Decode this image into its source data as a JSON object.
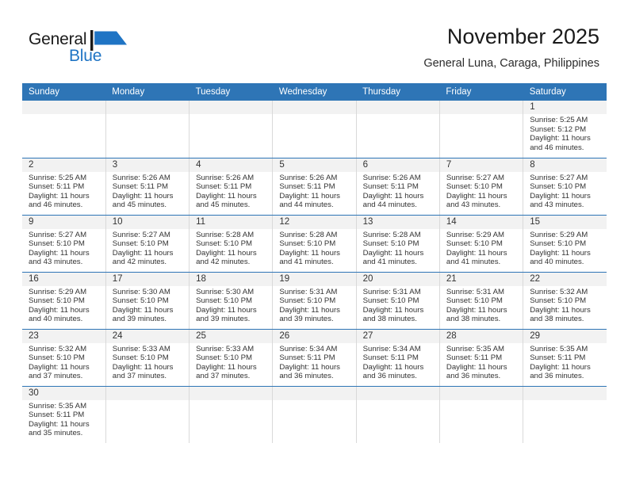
{
  "brand": {
    "name_top": "General",
    "name_bottom": "Blue",
    "accent_color": "#1f74c4",
    "flag_icon": "general-blue-flag"
  },
  "header": {
    "title": "November 2025",
    "subtitle": "General Luna, Caraga, Philippines"
  },
  "theme": {
    "header_blue": "#2e75b6",
    "daynum_band": "#f2f2f2",
    "cell_border": "#d9d9d9",
    "text": "#333333"
  },
  "calendar": {
    "weekday_headers": [
      "Sunday",
      "Monday",
      "Tuesday",
      "Wednesday",
      "Thursday",
      "Friday",
      "Saturday"
    ],
    "weeks": [
      [
        {
          "day": "",
          "empty": true,
          "sunrise": "",
          "sunset": "",
          "daylight_line1": "",
          "daylight_line2": ""
        },
        {
          "day": "",
          "empty": true,
          "sunrise": "",
          "sunset": "",
          "daylight_line1": "",
          "daylight_line2": ""
        },
        {
          "day": "",
          "empty": true,
          "sunrise": "",
          "sunset": "",
          "daylight_line1": "",
          "daylight_line2": ""
        },
        {
          "day": "",
          "empty": true,
          "sunrise": "",
          "sunset": "",
          "daylight_line1": "",
          "daylight_line2": ""
        },
        {
          "day": "",
          "empty": true,
          "sunrise": "",
          "sunset": "",
          "daylight_line1": "",
          "daylight_line2": ""
        },
        {
          "day": "",
          "empty": true,
          "sunrise": "",
          "sunset": "",
          "daylight_line1": "",
          "daylight_line2": ""
        },
        {
          "day": "1",
          "empty": false,
          "sunrise": "Sunrise: 5:25 AM",
          "sunset": "Sunset: 5:12 PM",
          "daylight_line1": "Daylight: 11 hours",
          "daylight_line2": "and 46 minutes."
        }
      ],
      [
        {
          "day": "2",
          "empty": false,
          "sunrise": "Sunrise: 5:25 AM",
          "sunset": "Sunset: 5:11 PM",
          "daylight_line1": "Daylight: 11 hours",
          "daylight_line2": "and 46 minutes."
        },
        {
          "day": "3",
          "empty": false,
          "sunrise": "Sunrise: 5:26 AM",
          "sunset": "Sunset: 5:11 PM",
          "daylight_line1": "Daylight: 11 hours",
          "daylight_line2": "and 45 minutes."
        },
        {
          "day": "4",
          "empty": false,
          "sunrise": "Sunrise: 5:26 AM",
          "sunset": "Sunset: 5:11 PM",
          "daylight_line1": "Daylight: 11 hours",
          "daylight_line2": "and 45 minutes."
        },
        {
          "day": "5",
          "empty": false,
          "sunrise": "Sunrise: 5:26 AM",
          "sunset": "Sunset: 5:11 PM",
          "daylight_line1": "Daylight: 11 hours",
          "daylight_line2": "and 44 minutes."
        },
        {
          "day": "6",
          "empty": false,
          "sunrise": "Sunrise: 5:26 AM",
          "sunset": "Sunset: 5:11 PM",
          "daylight_line1": "Daylight: 11 hours",
          "daylight_line2": "and 44 minutes."
        },
        {
          "day": "7",
          "empty": false,
          "sunrise": "Sunrise: 5:27 AM",
          "sunset": "Sunset: 5:10 PM",
          "daylight_line1": "Daylight: 11 hours",
          "daylight_line2": "and 43 minutes."
        },
        {
          "day": "8",
          "empty": false,
          "sunrise": "Sunrise: 5:27 AM",
          "sunset": "Sunset: 5:10 PM",
          "daylight_line1": "Daylight: 11 hours",
          "daylight_line2": "and 43 minutes."
        }
      ],
      [
        {
          "day": "9",
          "empty": false,
          "sunrise": "Sunrise: 5:27 AM",
          "sunset": "Sunset: 5:10 PM",
          "daylight_line1": "Daylight: 11 hours",
          "daylight_line2": "and 43 minutes."
        },
        {
          "day": "10",
          "empty": false,
          "sunrise": "Sunrise: 5:27 AM",
          "sunset": "Sunset: 5:10 PM",
          "daylight_line1": "Daylight: 11 hours",
          "daylight_line2": "and 42 minutes."
        },
        {
          "day": "11",
          "empty": false,
          "sunrise": "Sunrise: 5:28 AM",
          "sunset": "Sunset: 5:10 PM",
          "daylight_line1": "Daylight: 11 hours",
          "daylight_line2": "and 42 minutes."
        },
        {
          "day": "12",
          "empty": false,
          "sunrise": "Sunrise: 5:28 AM",
          "sunset": "Sunset: 5:10 PM",
          "daylight_line1": "Daylight: 11 hours",
          "daylight_line2": "and 41 minutes."
        },
        {
          "day": "13",
          "empty": false,
          "sunrise": "Sunrise: 5:28 AM",
          "sunset": "Sunset: 5:10 PM",
          "daylight_line1": "Daylight: 11 hours",
          "daylight_line2": "and 41 minutes."
        },
        {
          "day": "14",
          "empty": false,
          "sunrise": "Sunrise: 5:29 AM",
          "sunset": "Sunset: 5:10 PM",
          "daylight_line1": "Daylight: 11 hours",
          "daylight_line2": "and 41 minutes."
        },
        {
          "day": "15",
          "empty": false,
          "sunrise": "Sunrise: 5:29 AM",
          "sunset": "Sunset: 5:10 PM",
          "daylight_line1": "Daylight: 11 hours",
          "daylight_line2": "and 40 minutes."
        }
      ],
      [
        {
          "day": "16",
          "empty": false,
          "sunrise": "Sunrise: 5:29 AM",
          "sunset": "Sunset: 5:10 PM",
          "daylight_line1": "Daylight: 11 hours",
          "daylight_line2": "and 40 minutes."
        },
        {
          "day": "17",
          "empty": false,
          "sunrise": "Sunrise: 5:30 AM",
          "sunset": "Sunset: 5:10 PM",
          "daylight_line1": "Daylight: 11 hours",
          "daylight_line2": "and 39 minutes."
        },
        {
          "day": "18",
          "empty": false,
          "sunrise": "Sunrise: 5:30 AM",
          "sunset": "Sunset: 5:10 PM",
          "daylight_line1": "Daylight: 11 hours",
          "daylight_line2": "and 39 minutes."
        },
        {
          "day": "19",
          "empty": false,
          "sunrise": "Sunrise: 5:31 AM",
          "sunset": "Sunset: 5:10 PM",
          "daylight_line1": "Daylight: 11 hours",
          "daylight_line2": "and 39 minutes."
        },
        {
          "day": "20",
          "empty": false,
          "sunrise": "Sunrise: 5:31 AM",
          "sunset": "Sunset: 5:10 PM",
          "daylight_line1": "Daylight: 11 hours",
          "daylight_line2": "and 38 minutes."
        },
        {
          "day": "21",
          "empty": false,
          "sunrise": "Sunrise: 5:31 AM",
          "sunset": "Sunset: 5:10 PM",
          "daylight_line1": "Daylight: 11 hours",
          "daylight_line2": "and 38 minutes."
        },
        {
          "day": "22",
          "empty": false,
          "sunrise": "Sunrise: 5:32 AM",
          "sunset": "Sunset: 5:10 PM",
          "daylight_line1": "Daylight: 11 hours",
          "daylight_line2": "and 38 minutes."
        }
      ],
      [
        {
          "day": "23",
          "empty": false,
          "sunrise": "Sunrise: 5:32 AM",
          "sunset": "Sunset: 5:10 PM",
          "daylight_line1": "Daylight: 11 hours",
          "daylight_line2": "and 37 minutes."
        },
        {
          "day": "24",
          "empty": false,
          "sunrise": "Sunrise: 5:33 AM",
          "sunset": "Sunset: 5:10 PM",
          "daylight_line1": "Daylight: 11 hours",
          "daylight_line2": "and 37 minutes."
        },
        {
          "day": "25",
          "empty": false,
          "sunrise": "Sunrise: 5:33 AM",
          "sunset": "Sunset: 5:10 PM",
          "daylight_line1": "Daylight: 11 hours",
          "daylight_line2": "and 37 minutes."
        },
        {
          "day": "26",
          "empty": false,
          "sunrise": "Sunrise: 5:34 AM",
          "sunset": "Sunset: 5:11 PM",
          "daylight_line1": "Daylight: 11 hours",
          "daylight_line2": "and 36 minutes."
        },
        {
          "day": "27",
          "empty": false,
          "sunrise": "Sunrise: 5:34 AM",
          "sunset": "Sunset: 5:11 PM",
          "daylight_line1": "Daylight: 11 hours",
          "daylight_line2": "and 36 minutes."
        },
        {
          "day": "28",
          "empty": false,
          "sunrise": "Sunrise: 5:35 AM",
          "sunset": "Sunset: 5:11 PM",
          "daylight_line1": "Daylight: 11 hours",
          "daylight_line2": "and 36 minutes."
        },
        {
          "day": "29",
          "empty": false,
          "sunrise": "Sunrise: 5:35 AM",
          "sunset": "Sunset: 5:11 PM",
          "daylight_line1": "Daylight: 11 hours",
          "daylight_line2": "and 36 minutes."
        }
      ],
      [
        {
          "day": "30",
          "empty": false,
          "sunrise": "Sunrise: 5:35 AM",
          "sunset": "Sunset: 5:11 PM",
          "daylight_line1": "Daylight: 11 hours",
          "daylight_line2": "and 35 minutes."
        },
        {
          "day": "",
          "empty": true,
          "sunrise": "",
          "sunset": "",
          "daylight_line1": "",
          "daylight_line2": ""
        },
        {
          "day": "",
          "empty": true,
          "sunrise": "",
          "sunset": "",
          "daylight_line1": "",
          "daylight_line2": ""
        },
        {
          "day": "",
          "empty": true,
          "sunrise": "",
          "sunset": "",
          "daylight_line1": "",
          "daylight_line2": ""
        },
        {
          "day": "",
          "empty": true,
          "sunrise": "",
          "sunset": "",
          "daylight_line1": "",
          "daylight_line2": ""
        },
        {
          "day": "",
          "empty": true,
          "sunrise": "",
          "sunset": "",
          "daylight_line1": "",
          "daylight_line2": ""
        },
        {
          "day": "",
          "empty": true,
          "sunrise": "",
          "sunset": "",
          "daylight_line1": "",
          "daylight_line2": ""
        }
      ]
    ]
  }
}
